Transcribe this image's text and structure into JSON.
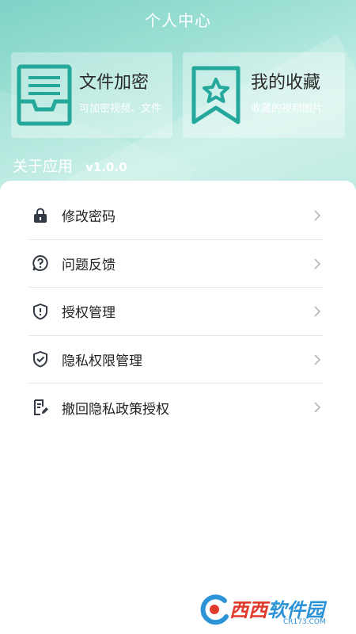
{
  "header": {
    "title": "个人中心"
  },
  "cards": [
    {
      "title": "文件加密",
      "subtitle": "可加密视频、文件",
      "icon": "file-tray-icon"
    },
    {
      "title": "我的收藏",
      "subtitle": "收藏的视频图片",
      "icon": "bookmark-star-icon"
    }
  ],
  "about": {
    "label": "关于应用",
    "version": "v1.0.0"
  },
  "menu": [
    {
      "label": "修改密码",
      "icon": "lock-icon"
    },
    {
      "label": "问题反馈",
      "icon": "question-bubble-icon"
    },
    {
      "label": "授权管理",
      "icon": "shield-exclaim-icon"
    },
    {
      "label": "隐私权限管理",
      "icon": "shield-check-icon"
    },
    {
      "label": "撤回隐私政策授权",
      "icon": "document-edit-icon"
    }
  ],
  "watermark": {
    "brand_a": "西西",
    "brand_b": "软件园",
    "domain": "CR173.COM"
  },
  "colors": {
    "accent": "#23a89b",
    "header_start": "#7dd3c6",
    "header_end": "#c4eee6",
    "menu_icon": "#333a45"
  }
}
